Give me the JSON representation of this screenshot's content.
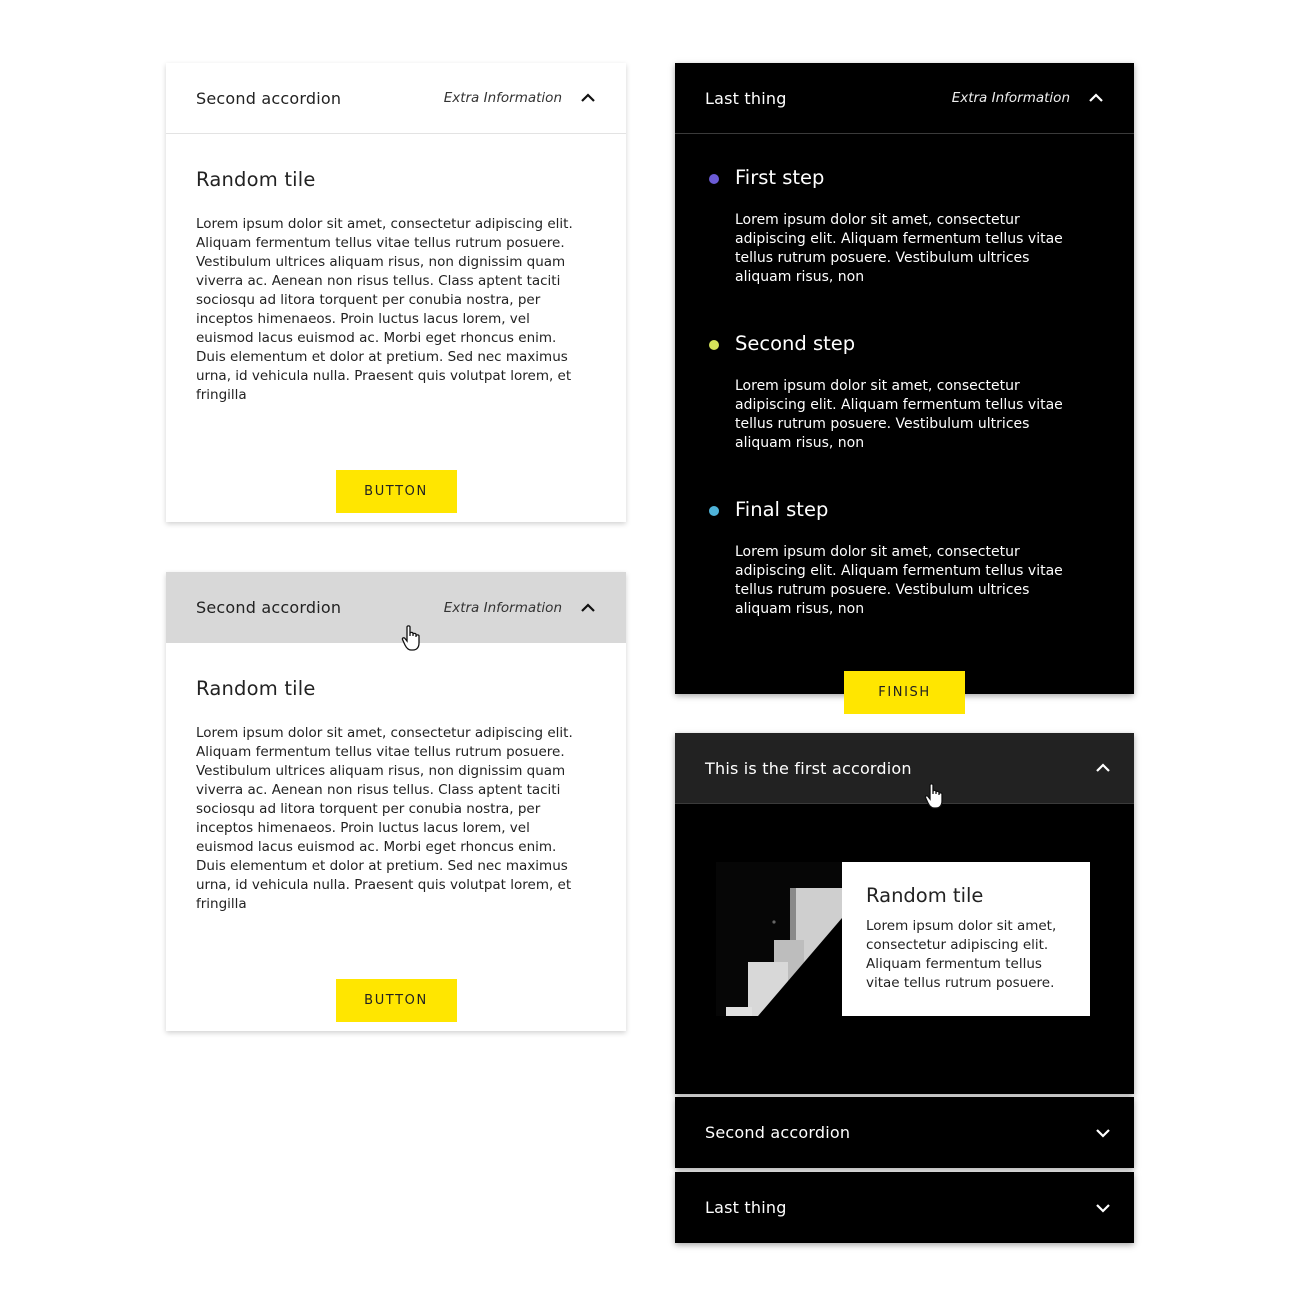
{
  "card1": {
    "header_title": "Second accordion",
    "extra": "Extra Information",
    "tile_title": "Random tile",
    "tile_text": "Lorem ipsum dolor sit amet, consectetur adipiscing elit. Aliquam fermentum tellus vitae tellus rutrum posuere. Vestibulum ultrices aliquam risus, non dignissim quam viverra ac. Aenean non risus tellus. Class aptent taciti sociosqu ad litora torquent per conubia nostra, per inceptos himenaeos. Proin luctus lacus lorem, vel euismod lacus euismod ac. Morbi eget rhoncus enim. Duis elementum et dolor at pretium. Sed nec maximus urna, id vehicula nulla. Praesent quis volutpat lorem, et fringilla",
    "button_label": "BUTTON"
  },
  "card2": {
    "header_title": "Second accordion",
    "extra": "Extra Information",
    "tile_title": "Random tile",
    "tile_text": "Lorem ipsum dolor sit amet, consectetur adipiscing elit. Aliquam fermentum tellus vitae tellus rutrum posuere. Vestibulum ultrices aliquam risus, non dignissim quam viverra ac. Aenean non risus tellus. Class aptent taciti sociosqu ad litora torquent per conubia nostra, per inceptos himenaeos. Proin luctus lacus lorem, vel euismod lacus euismod ac. Morbi eget rhoncus enim. Duis elementum et dolor at pretium. Sed nec maximus urna, id vehicula nulla. Praesent quis volutpat lorem, et fringilla",
    "button_label": "BUTTON"
  },
  "card3": {
    "header_title": "Last thing",
    "extra": "Extra Information",
    "steps": [
      {
        "title": "First step",
        "text": "Lorem ipsum dolor sit amet, consectetur adipiscing elit. Aliquam fermentum tellus vitae tellus rutrum posuere. Vestibulum ultrices aliquam risus, non",
        "color": "#6b5bd6"
      },
      {
        "title": "Second step",
        "text": "Lorem ipsum dolor sit amet, consectetur adipiscing elit. Aliquam fermentum tellus vitae tellus rutrum posuere. Vestibulum ultrices aliquam risus, non",
        "color": "#d6e35a"
      },
      {
        "title": "Final step",
        "text": "Lorem ipsum dolor sit amet, consectetur adipiscing elit. Aliquam fermentum tellus vitae tellus rutrum posuere. Vestibulum ultrices aliquam risus, non",
        "color": "#4fb3d9"
      }
    ],
    "button_label": "FINISH"
  },
  "card4": {
    "first_title": "This is the first accordion",
    "tile_title": "Random tile",
    "tile_text": "Lorem ipsum dolor sit amet, consectetur adipiscing elit. Aliquam fermentum tellus vitae tellus rutrum posuere.",
    "second_title": "Second accordion",
    "last_title": "Last thing"
  },
  "colors": {
    "accent": "#ffe600",
    "hover_light": "#d8d8d8",
    "hover_dark": "#222222"
  }
}
